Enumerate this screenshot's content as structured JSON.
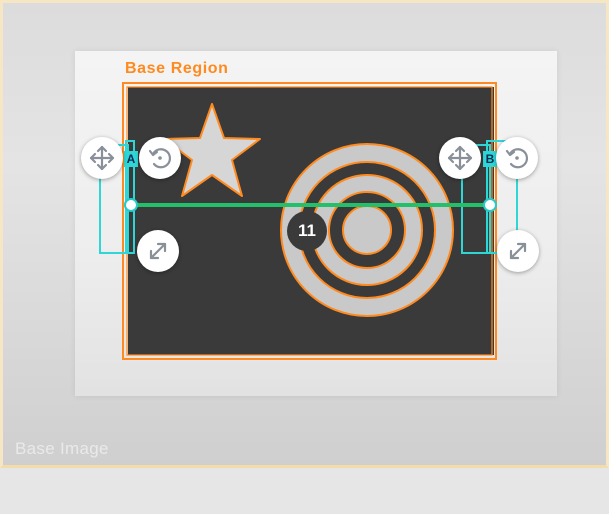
{
  "overlay": {
    "region_label": "Base Region",
    "watermark": "Base Image",
    "measurement_badge": "11",
    "anchors": [
      {
        "tag": "A",
        "move_icon": "move-icon",
        "rotate_icon": "rotate-icon",
        "resize_icon": "resize-icon"
      },
      {
        "tag": "B",
        "move_icon": "move-icon",
        "rotate_icon": "rotate-icon",
        "resize_icon": "resize-icon"
      }
    ]
  },
  "colors": {
    "region_outline": "#ff8a1f",
    "anchor_cyan": "#2fd6d6",
    "measure_line": "#22c06a",
    "target_dark": "#383838"
  }
}
